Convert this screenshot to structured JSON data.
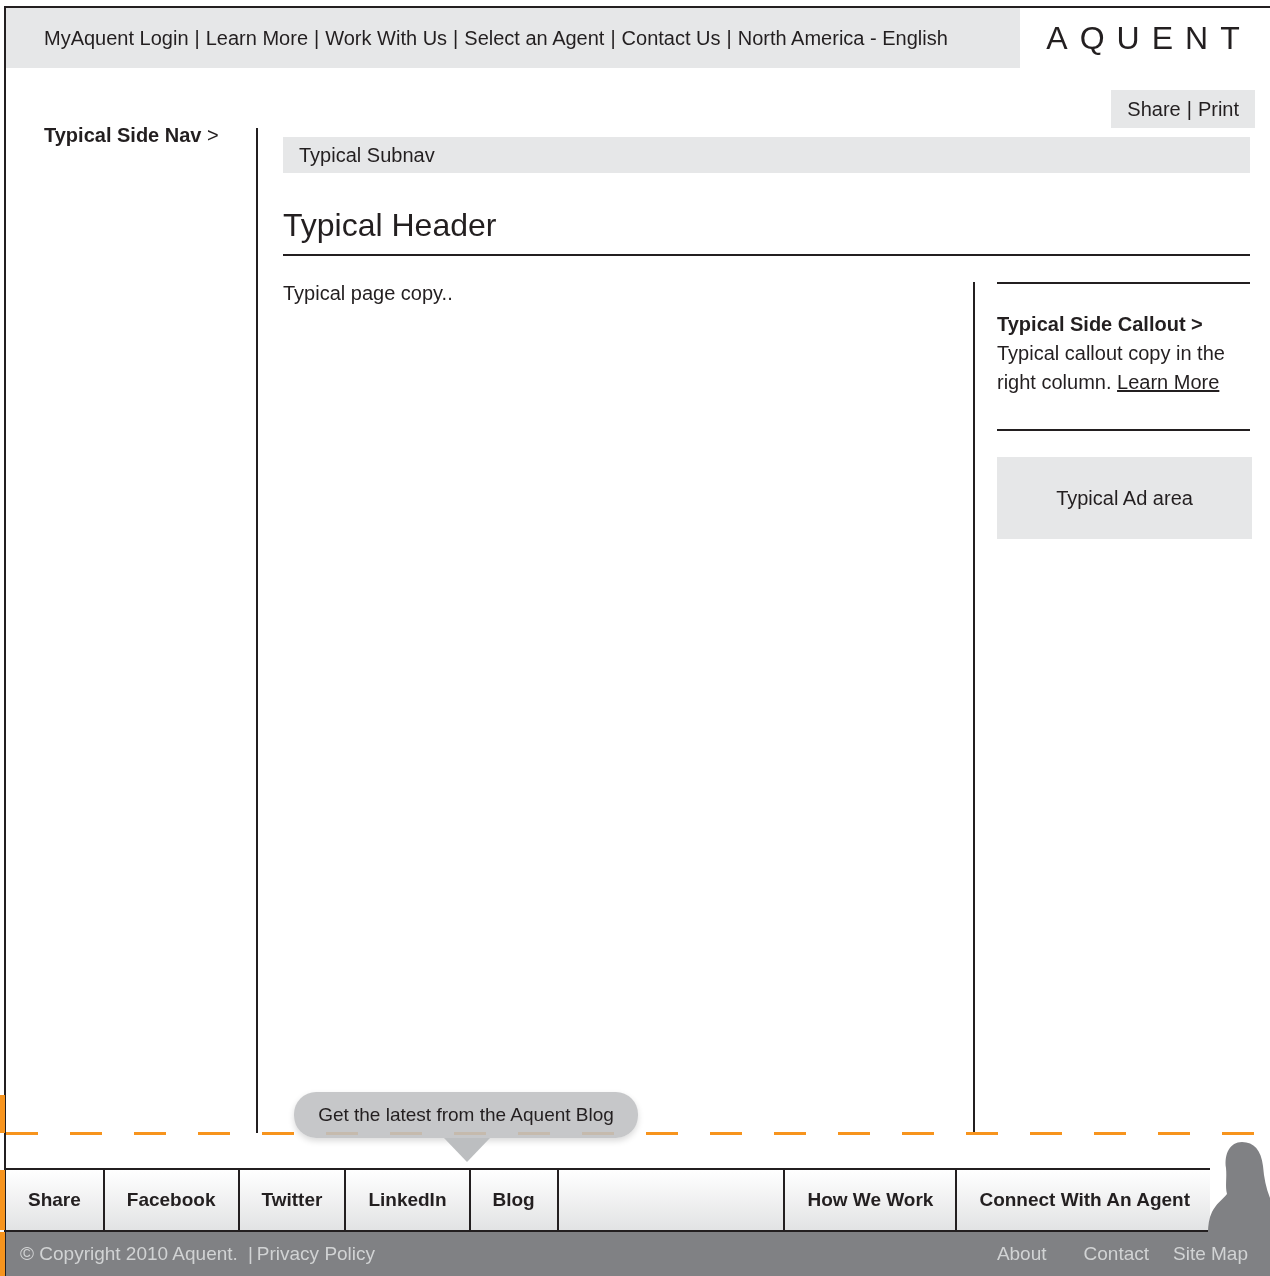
{
  "top_nav": {
    "separator": "|",
    "links": [
      "MyAquent Login",
      "Learn More",
      "Work With Us",
      "Select an Agent",
      "Contact Us",
      "North America - English"
    ]
  },
  "logo": "AQUENT",
  "page_tools": {
    "separator": "|",
    "links": [
      "Share",
      "Print"
    ]
  },
  "side_nav": {
    "label": "Typical Side Nav",
    "arrow": ">"
  },
  "subnav": "Typical Subnav",
  "header": "Typical Header",
  "copy": "Typical page copy..",
  "callout": {
    "title": "Typical Side Callout >",
    "text": "Typical callout copy in the right column.",
    "link": "Learn More"
  },
  "ad": "Typical Ad area",
  "blog_tooltip": "Get the latest from the Aquent Blog",
  "share_bar": {
    "left": [
      "Share",
      "Facebook",
      "Twitter",
      "LinkedIn",
      "Blog"
    ],
    "right": [
      "How We Work",
      "Connect With An Agent"
    ]
  },
  "footer": {
    "copyright": "© Copyright 2010 Aquent.",
    "separator": "|",
    "privacy": "Privacy Policy",
    "links": [
      "About",
      "Contact",
      "Site Map"
    ]
  }
}
